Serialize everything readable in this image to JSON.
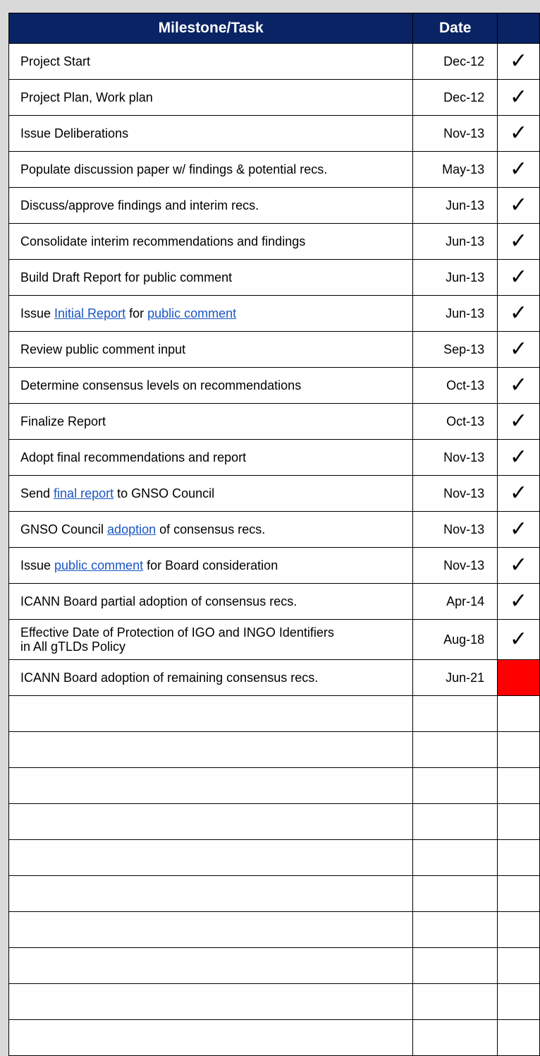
{
  "header": {
    "milestone": "Milestone/Task",
    "date": "Date"
  },
  "rows": [
    {
      "task": "Project Start",
      "date": "Dec-12",
      "status": "✓"
    },
    {
      "task": "Project Plan, Work plan",
      "date": "Dec-12",
      "status": "✓"
    },
    {
      "task": "Issue Deliberations",
      "date": "Nov-13",
      "status": "✓"
    },
    {
      "task": "Populate discussion paper w/ findings & potential recs.",
      "date": "May-13",
      "status": "✓"
    },
    {
      "task": "Discuss/approve findings and interim recs.",
      "date": "Jun-13",
      "status": "✓"
    },
    {
      "task": "Consolidate interim recommendations and findings",
      "date": "Jun-13",
      "status": "✓"
    },
    {
      "task": "Build Draft Report for public comment",
      "date": "Jun-13",
      "status": "✓"
    },
    {
      "task_pre": "Issue ",
      "task_link1": "Initial Report",
      "task_mid": " for ",
      "task_link2": "public comment",
      "date": "Jun-13",
      "status": "✓"
    },
    {
      "task": "Review public comment input",
      "date": "Sep-13",
      "status": "✓"
    },
    {
      "task": "Determine consensus levels on recommendations",
      "date": "Oct-13",
      "status": "✓"
    },
    {
      "task": "Finalize Report",
      "date": "Oct-13",
      "status": "✓"
    },
    {
      "task": "Adopt final recommendations and report",
      "date": "Nov-13",
      "status": "✓"
    },
    {
      "task_pre": "Send ",
      "task_link1": "final report",
      "task_post": " to GNSO Council",
      "date": "Nov-13",
      "status": "✓"
    },
    {
      "task_pre": "GNSO Council ",
      "task_link1": "adoption",
      "task_post": " of consensus recs.",
      "date": "Nov-13",
      "status": "✓"
    },
    {
      "task_pre": "Issue ",
      "task_link1": "public comment",
      "task_post": " for Board consideration",
      "date": "Nov-13",
      "status": "✓"
    },
    {
      "task": "ICANN Board partial adoption of consensus recs.",
      "date": "Apr-14",
      "status": "✓"
    },
    {
      "task_line1": "Effective Date of Protection of IGO and INGO Identifiers",
      "task_line2": "in All gTLDs Policy",
      "date": "Aug-18",
      "status": "✓"
    },
    {
      "task": "ICANN Board adoption of remaining consensus recs.",
      "date": "Jun-21",
      "status": "",
      "status_color": "#ff0000"
    }
  ],
  "empty_row_count": 10
}
